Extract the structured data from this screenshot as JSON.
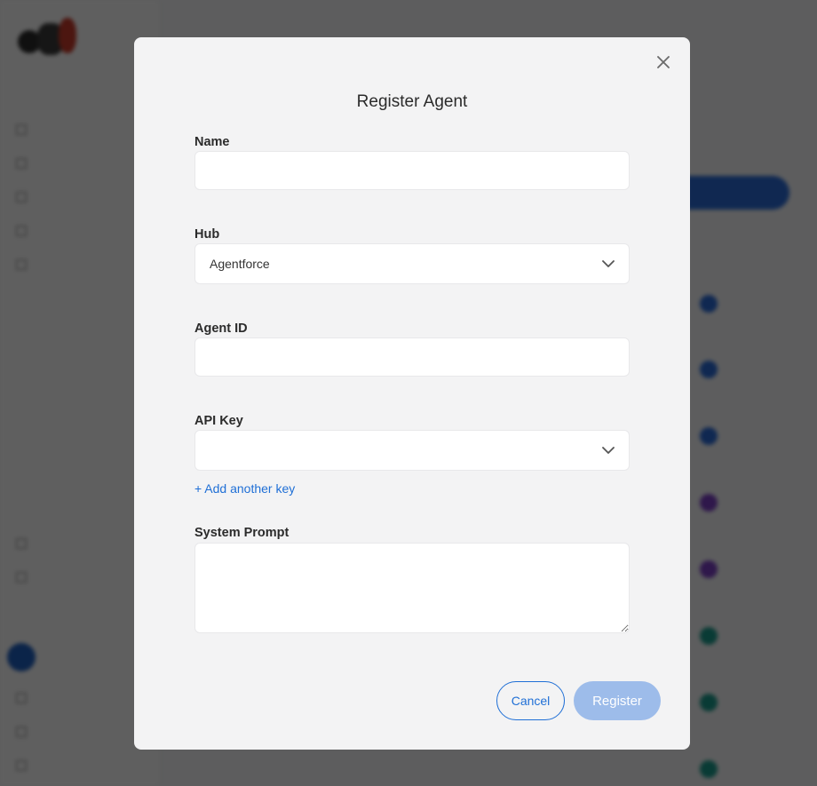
{
  "modal": {
    "title": "Register Agent",
    "fields": {
      "name": {
        "label": "Name",
        "value": ""
      },
      "hub": {
        "label": "Hub",
        "value": "Agentforce"
      },
      "agent_id": {
        "label": "Agent ID",
        "value": ""
      },
      "api_key": {
        "label": "API Key",
        "value": ""
      },
      "system_prompt": {
        "label": "System Prompt",
        "value": ""
      }
    },
    "add_key_label": "+ Add another key",
    "cancel_label": "Cancel",
    "register_label": "Register"
  },
  "icons": {
    "close": "close-icon",
    "chevron": "chevron-down-icon"
  },
  "colors": {
    "accent": "#1f6fd6",
    "register_disabled": "#9dbcea",
    "modal_bg": "#f3f3f4",
    "overlay": "#000000"
  }
}
